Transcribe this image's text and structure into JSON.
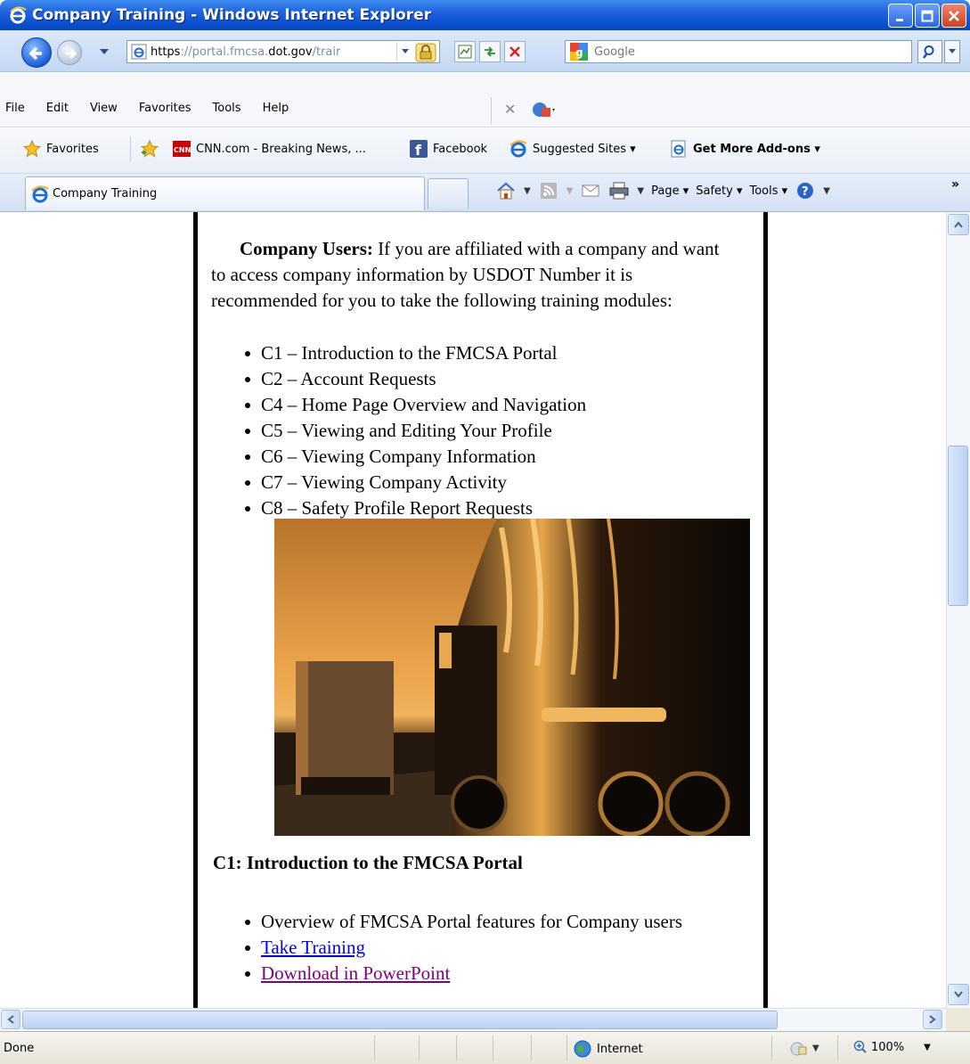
{
  "window": {
    "title": "Company Training - Windows Internet Explorer"
  },
  "address": {
    "url_scheme": "https",
    "url_sep": "://",
    "url_host_pre": "portal.fmcsa.",
    "url_host_main": "dot.gov",
    "url_path": "/trair",
    "search_placeholder": "Google"
  },
  "menu": {
    "items": [
      "File",
      "Edit",
      "View",
      "Favorites",
      "Tools",
      "Help"
    ]
  },
  "favorites": {
    "favorites_label": "Favorites",
    "cnn": "CNN.com - Breaking News, ...",
    "facebook": "Facebook",
    "suggested": "Suggested Sites ▾",
    "addons": "Get More Add-ons ▾"
  },
  "tabs": {
    "active": "Company Training"
  },
  "command_bar": {
    "page": "Page ▾",
    "safety": "Safety ▾",
    "tools": "Tools ▾"
  },
  "content": {
    "intro_bold": "Company Users:",
    "intro_text": " If you are affiliated with a company and want to access company information by USDOT Number it is recommended for you to take the following training modules:",
    "modules": [
      "C1 – Introduction to the FMCSA Portal",
      "C2 – Account Requests",
      "C4 – Home Page Overview and Navigation",
      "C5 – Viewing and Editing Your Profile",
      "C6 – Viewing Company Information",
      "C7 – Viewing Company Activity",
      "C8 – Safety Profile Report Requests"
    ],
    "c1_title": "C1: Introduction to the FMCSA Portal",
    "c1_overview": "Overview of FMCSA Portal features for Company users",
    "c1_take_training": "Take Training",
    "c1_download": "Download in PowerPoint"
  },
  "status": {
    "done": "Done",
    "zone": "Internet",
    "zoom": "100%"
  }
}
